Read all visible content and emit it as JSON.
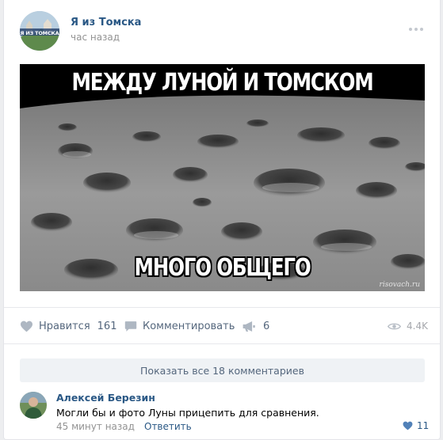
{
  "post": {
    "group_name": "Я из Томска",
    "avatar_text": "Я ИЗ ТОМСКА",
    "time": "час назад",
    "meme": {
      "top_text": "МЕЖДУ ЛУНОЙ И ТОМСКОМ",
      "bottom_text": "МНОГО ОБЩЕГО",
      "watermark": "risovach.ru"
    },
    "actions": {
      "like_label": "Нравится",
      "like_count": "161",
      "comment_label": "Комментировать",
      "share_count": "6",
      "views": "4.4K"
    }
  },
  "comments": {
    "show_all": "Показать все 18 комментариев",
    "items": [
      {
        "author": "Алексей Березин",
        "text": "Могли бы и фото Луны прицепить для сравнения.",
        "time": "45 минут назад",
        "reply_label": "Ответить",
        "likes": "11"
      }
    ]
  },
  "colors": {
    "link": "#2a5885",
    "action": "#55677d",
    "muted": "#939393",
    "background": "#edeef0"
  }
}
